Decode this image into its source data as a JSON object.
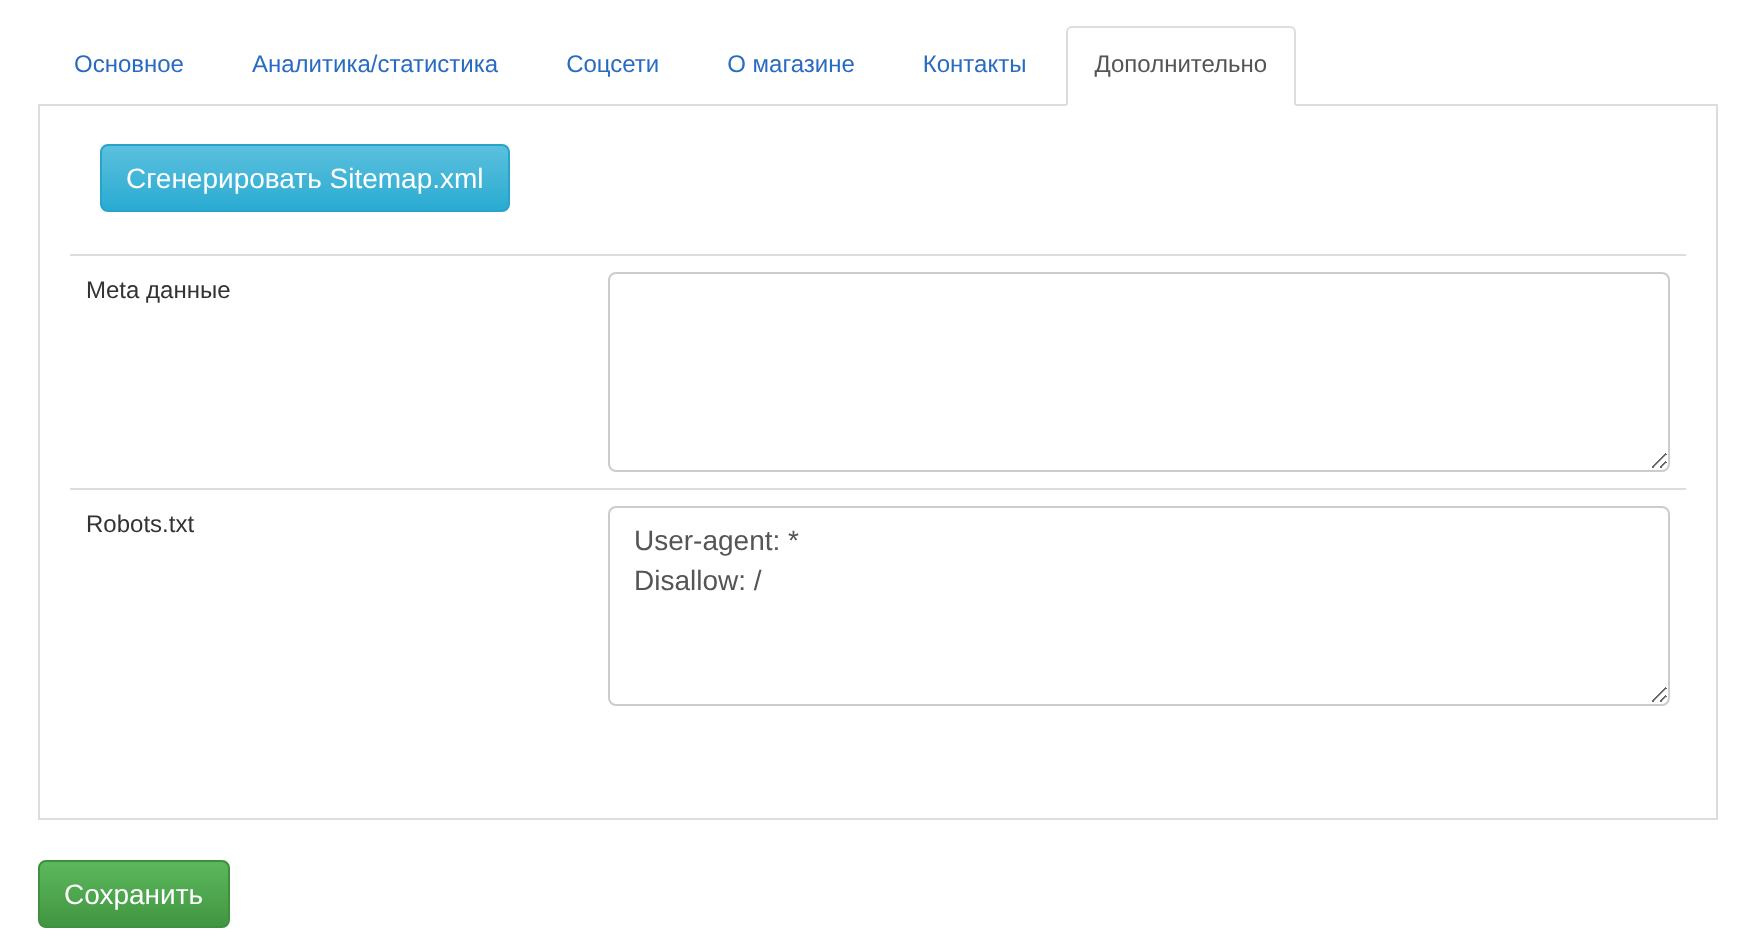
{
  "tabs": [
    {
      "label": "Основное",
      "selected": false
    },
    {
      "label": "Аналитика/статистика",
      "selected": false
    },
    {
      "label": "Соцсети",
      "selected": false
    },
    {
      "label": "О магазине",
      "selected": false
    },
    {
      "label": "Контакты",
      "selected": false
    },
    {
      "label": "Дополнительно",
      "selected": true
    }
  ],
  "generate_button": "Сгенерировать Sitemap.xml",
  "fields": [
    {
      "label": "Meta данные"
    },
    {
      "label": "Robots.txt",
      "value": "User-agent: *\nDisallow: /"
    }
  ],
  "save_button": "Сохранить"
}
